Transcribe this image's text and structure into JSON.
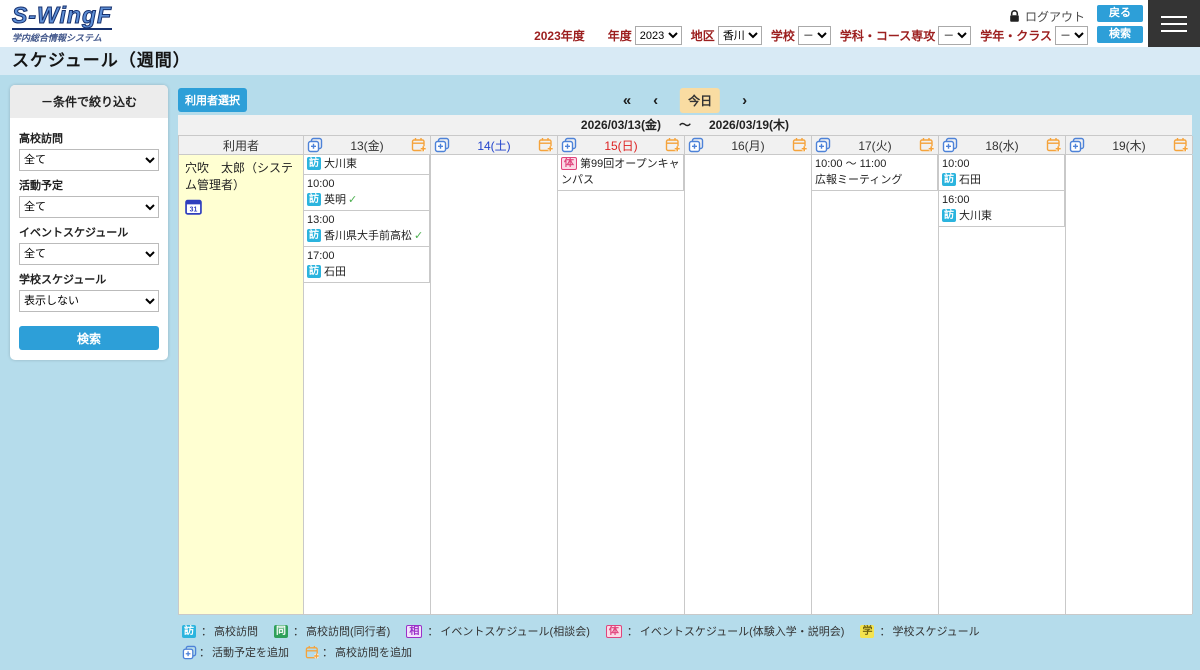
{
  "colors": {
    "accent-blue": "#2D9FD8",
    "today-bg": "#F9DCA2",
    "badge-visit": "#2BB4DE",
    "badge-companion": "#2FA05A",
    "badge-consult-text": "#9B30C8",
    "badge-consult-bg": "#F3E3FC",
    "badge-taiken-text": "#E0447C",
    "badge-taiken-bg": "#FBD9E6",
    "badge-school-bg": "#F4E34F",
    "badge-school-text": "#6E6212",
    "header-label": "#9C1F1F",
    "sunday": "#DD2222",
    "saturday": "#2244CC",
    "main-bg": "#B5DCEB",
    "titlebar-bg": "#D8EAF5",
    "user-col-bg": "#FFFFD2",
    "icon-blue": "#4D82D8",
    "icon-orange": "#F5A33B"
  },
  "header": {
    "logo_title": "S-WingF",
    "logo_subtitle": "学内総合情報システム",
    "year_text": "2023年度",
    "filters": [
      {
        "label": "年度",
        "value": "2023"
      },
      {
        "label": "地区",
        "value": "香川"
      },
      {
        "label": "学校",
        "value": "－"
      },
      {
        "label": "学科・コース専攻",
        "value": "－"
      },
      {
        "label": "学年・クラス",
        "value": "－"
      }
    ],
    "logout_label": "ログアウト",
    "back_button": "戻る",
    "search_button": "検索"
  },
  "page": {
    "title": "スケジュール（週間）"
  },
  "sidebar": {
    "title": "－条件で絞り込む",
    "fields": [
      {
        "label": "高校訪問",
        "value": "全て"
      },
      {
        "label": "活動予定",
        "value": "全て"
      },
      {
        "label": "イベントスケジュール",
        "value": "全て"
      },
      {
        "label": "学校スケジュール",
        "value": "表示しない"
      }
    ],
    "search_button": "検索"
  },
  "calendar": {
    "user_select_button": "利用者選択",
    "nav": {
      "prev_week": "«",
      "prev": "‹",
      "today": "今日",
      "next": "›"
    },
    "range": {
      "start": "2026/03/13(金)",
      "tilde": "～",
      "end": "2026/03/19(木)"
    },
    "user_column_header": "利用者",
    "user_name": "穴吹　太郎（システム管理者）",
    "check_mark": "✓",
    "days": [
      {
        "label": "13(金)",
        "events": [
          {
            "badge": "訪",
            "title": "大川東"
          },
          {
            "time": "10:00",
            "badge": "訪",
            "title": "英明",
            "check": "✓"
          },
          {
            "time": "13:00",
            "badge": "訪",
            "title": "香川県大手前高松",
            "check": "✓"
          },
          {
            "time": "17:00",
            "badge": "訪",
            "title": "石田"
          }
        ]
      },
      {
        "label": "14(土)",
        "events": []
      },
      {
        "label": "15(日)",
        "events": [
          {
            "badge": "体",
            "title": "第99回オープンキャンパス"
          }
        ]
      },
      {
        "label": "16(月)",
        "events": []
      },
      {
        "label": "17(火)",
        "events": [
          {
            "time": "10:00 ～ 11:00",
            "title": "広報ミーティング"
          }
        ]
      },
      {
        "label": "18(水)",
        "events": [
          {
            "time": "10:00",
            "badge": "訪",
            "title": "石田"
          },
          {
            "time": "16:00",
            "badge": "訪",
            "title": "大川東"
          }
        ]
      },
      {
        "label": "19(木)",
        "events": []
      }
    ]
  },
  "legend": {
    "sep": "：",
    "row1": [
      {
        "badge": "訪",
        "label": "高校訪問"
      },
      {
        "badge": "同",
        "label": "高校訪問(同行者)"
      },
      {
        "badge": "相",
        "label": "イベントスケジュール(相談会)"
      },
      {
        "badge": "体",
        "label": "イベントスケジュール(体験入学・説明会)"
      },
      {
        "badge": "学",
        "label": "学校スケジュール"
      }
    ],
    "row2": [
      {
        "label": "活動予定を追加"
      },
      {
        "label": "高校訪問を追加"
      }
    ]
  }
}
